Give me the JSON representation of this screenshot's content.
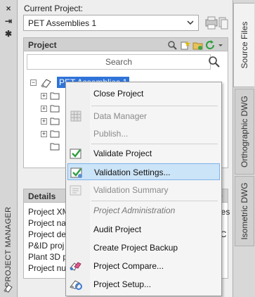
{
  "left_strip": {
    "title": "PROJECT MANAGER",
    "buttons": [
      "×",
      "⇥",
      "✱"
    ]
  },
  "current_project": {
    "label": "Current Project:",
    "selected": "PET Assemblies 1"
  },
  "project_section": {
    "title": "Project",
    "search_placeholder": "Search",
    "tree_root": "PET Assemblies 1"
  },
  "details_section": {
    "title": "Details",
    "lines": [
      "Project XM",
      "Project na",
      "Project de",
      "P&ID proj",
      "Plant 3D p",
      "Project nu"
    ],
    "right_fragments": [
      "ssemblies",
      "ut PT C"
    ]
  },
  "right_tabs": [
    "Source Files",
    "Orthographic DWG",
    "Isometric DWG"
  ],
  "context_menu": {
    "items": [
      {
        "label": "Close Project",
        "state": "normal",
        "icon": ""
      },
      {
        "label": "Data Manager",
        "state": "disabled",
        "icon": "grid-icon"
      },
      {
        "label": "Publish...",
        "state": "disabled",
        "icon": ""
      },
      {
        "label": "Validate Project",
        "state": "normal",
        "icon": "validate-icon"
      },
      {
        "label": "Validation Settings...",
        "state": "hover",
        "icon": "validation-settings-icon"
      },
      {
        "label": "Validation Summary",
        "state": "disabled",
        "icon": "summary-icon"
      },
      {
        "label": "Project Administration",
        "state": "header",
        "icon": ""
      },
      {
        "label": "Audit Project",
        "state": "normal",
        "icon": ""
      },
      {
        "label": "Create Project Backup",
        "state": "normal",
        "icon": ""
      },
      {
        "label": "Project Compare...",
        "state": "normal",
        "icon": "compare-icon"
      },
      {
        "label": "Project Setup...",
        "state": "normal",
        "icon": "setup-icon"
      }
    ]
  },
  "colors": {
    "selection_blue": "#2f73d8",
    "menu_hover": "#cce4f7",
    "menu_hover_border": "#7eb4ea",
    "check_green": "#2e9e3e"
  }
}
